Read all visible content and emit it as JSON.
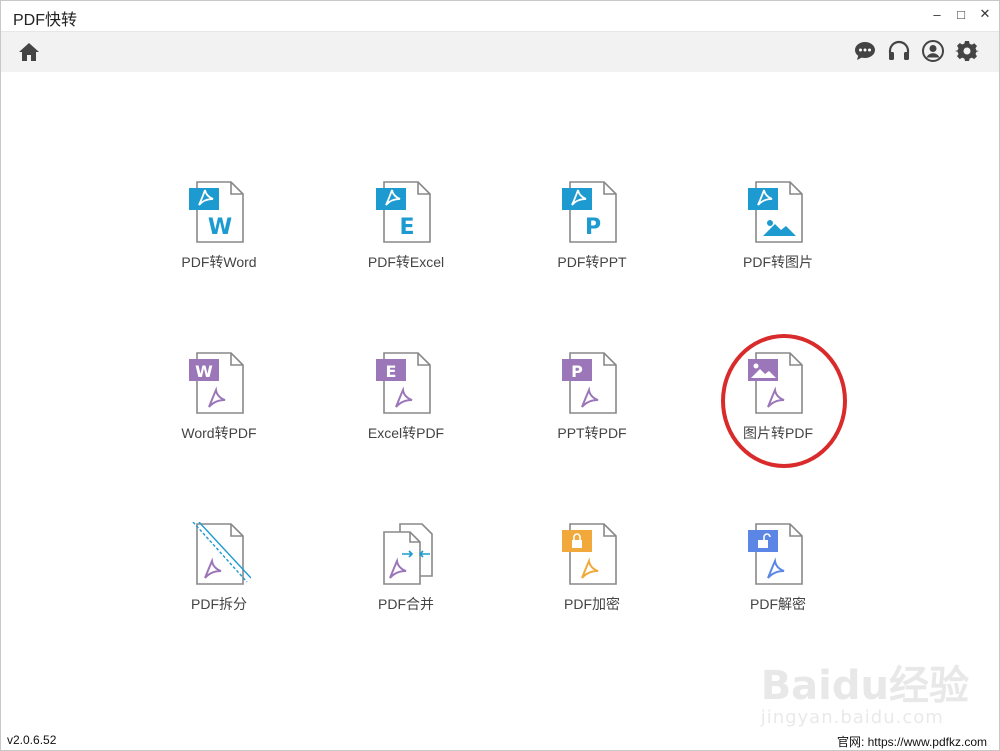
{
  "app": {
    "title": "PDF快转"
  },
  "window_controls": {
    "minimize": "–",
    "maximize": "□",
    "close": "✕"
  },
  "toolbar": {
    "home_icon": "home-icon",
    "icons": [
      "chat-icon",
      "headset-icon",
      "user-icon",
      "gear-icon"
    ]
  },
  "colors": {
    "pdf_blue": "#1d9bd1",
    "office_purple": "#9b76b8",
    "lock_orange": "#f2a93b",
    "unlock_blue": "#5b86e5",
    "highlight_red": "#d92b2b"
  },
  "tiles": [
    {
      "label": "PDF转Word",
      "badge": "pdf",
      "letter": "W"
    },
    {
      "label": "PDF转Excel",
      "badge": "pdf",
      "letter": "E"
    },
    {
      "label": "PDF转PPT",
      "badge": "pdf",
      "letter": "P"
    },
    {
      "label": "PDF转图片",
      "badge": "pdf",
      "letter": "image"
    },
    {
      "label": "Word转PDF",
      "badge": "W",
      "letter": "pdf"
    },
    {
      "label": "Excel转PDF",
      "badge": "E",
      "letter": "pdf"
    },
    {
      "label": "PPT转PDF",
      "badge": "P",
      "letter": "pdf"
    },
    {
      "label": "图片转PDF",
      "badge": "image",
      "letter": "pdf"
    },
    {
      "label": "PDF拆分",
      "badge": "split",
      "letter": "pdf"
    },
    {
      "label": "PDF合并",
      "badge": "merge",
      "letter": "pdf"
    },
    {
      "label": "PDF加密",
      "badge": "lock",
      "letter": "pdf"
    },
    {
      "label": "PDF解密",
      "badge": "unlock",
      "letter": "pdf"
    }
  ],
  "status": {
    "version": "v2.0.6.52",
    "website": "官网: https://www.pdfkz.com"
  },
  "watermark": {
    "brand": "Baidu经验",
    "sub": "jingyan.baidu.com"
  }
}
